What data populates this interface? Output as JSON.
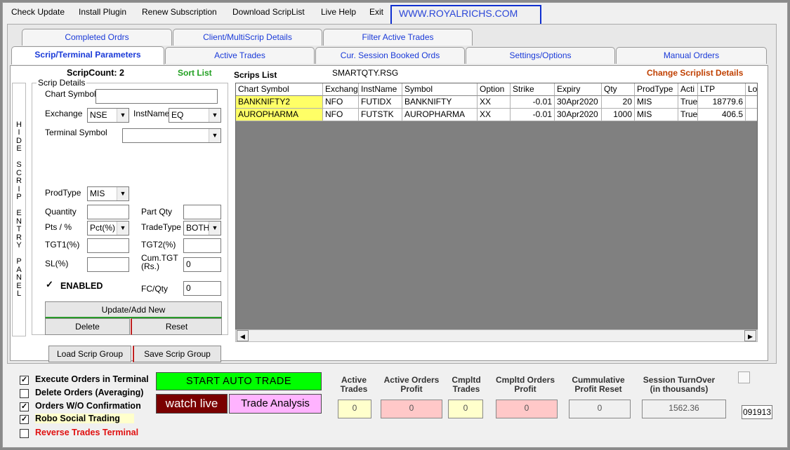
{
  "menu": {
    "items": [
      "Check Update",
      "Install Plugin",
      "Renew Subscription",
      "Download ScripList",
      "Live Help",
      "Exit"
    ],
    "website": "WWW.ROYALRICHS.COM"
  },
  "tabs_row1": [
    "Completed Ordrs",
    "Client/MultiScrip Details",
    "Filter Active Trades"
  ],
  "tabs_row2": [
    "Scrip/Terminal Parameters",
    "Active Trades",
    "Cur. Session Booked Ords",
    "Settings/Options",
    "Manual Orders"
  ],
  "hide_panel_text": [
    "H",
    "I",
    "D",
    "E",
    "",
    "S",
    "C",
    "R",
    "I",
    "P",
    "",
    "E",
    "N",
    "T",
    "R",
    "Y",
    "",
    "P",
    "A",
    "N",
    "E",
    "L"
  ],
  "scrip": {
    "count_label": "ScripCount: 2",
    "sort_list": "Sort List",
    "scrips_list": "Scrips List",
    "file_name": "SMARTQTY.RSG",
    "change_scriplist": "Change Scriplist Details",
    "details_title": "Scrip Details",
    "chart_symbol_label": "Chart Symbol",
    "chart_symbol_value": "",
    "exchange_label": "Exchange",
    "exchange_value": "NSE",
    "instname_label": "InstName",
    "instname_value": "EQ",
    "terminal_symbol_label": "Terminal Symbol",
    "terminal_symbol_value": "",
    "prodtype_label": "ProdType",
    "prodtype_value": "MIS",
    "quantity_label": "Quantity",
    "quantity_value": "",
    "partqty_label": "Part Qty",
    "partqty_value": "",
    "pts_label": "Pts / %",
    "pts_value": "Pct(%)",
    "tradetype_label": "TradeType",
    "tradetype_value": "BOTH",
    "tgt1_label": "TGT1(%)",
    "tgt1_value": "",
    "tgt2_label": "TGT2(%)",
    "tgt2_value": "",
    "sl_label": "SL(%)",
    "sl_value": "",
    "cumtgt_label": "Cum.TGT (Rs.)",
    "cumtgt_value": "0",
    "enabled_label": "ENABLED",
    "fcqty_label": "FC/Qty",
    "fcqty_value": "0",
    "update_btn": "Update/Add New",
    "delete_btn": "Delete",
    "reset_btn": "Reset",
    "load_group_btn": "Load Scrip Group",
    "save_group_btn": "Save Scrip Group"
  },
  "grid": {
    "columns": [
      "Chart Symbol",
      "Exchang",
      "InstName",
      "Symbol",
      "Option",
      "Strike",
      "Expiry",
      "Qty",
      "ProdType",
      "Acti",
      "LTP",
      "Lo"
    ],
    "rows": [
      [
        "BANKNIFTY2",
        "NFO",
        "FUTIDX",
        "BANKNIFTY",
        "XX",
        "-0.01",
        "30Apr2020",
        "20",
        "MIS",
        "True",
        "18779.6",
        ""
      ],
      [
        "AUROPHARMA",
        "NFO",
        "FUTSTK",
        "AUROPHARMA",
        "XX",
        "-0.01",
        "30Apr2020",
        "1000",
        "MIS",
        "True",
        "406.5",
        ""
      ]
    ]
  },
  "bottom": {
    "checks": [
      {
        "label": "Execute Orders in Terminal",
        "checked": true
      },
      {
        "label": "Delete Orders (Averaging)",
        "checked": false
      },
      {
        "label": "Orders W/O Confirmation",
        "checked": true
      },
      {
        "label": "Robo Social Trading",
        "checked": true
      },
      {
        "label": "Reverse Trades Terminal",
        "checked": false
      }
    ],
    "start_btn": "START AUTO TRADE",
    "watch_btn": "watch live",
    "analysis_btn": "Trade Analysis",
    "stats": [
      {
        "h1": "Active",
        "h2": "Trades",
        "value": "0"
      },
      {
        "h1": "Active Orders",
        "h2": "Profit",
        "value": "0"
      },
      {
        "h1": "Cmpltd",
        "h2": "Trades",
        "value": "0"
      },
      {
        "h1": "Cmpltd Orders",
        "h2": "Profit",
        "value": "0"
      },
      {
        "h1": "Cummulative",
        "h2": "Profit Reset",
        "value": "0"
      },
      {
        "h1": "Session TurnOver",
        "h2": "(in thousands)",
        "value": "1562.36"
      }
    ],
    "code": "091913"
  },
  "colors": {
    "tab_text": "#1a3ad8",
    "sort_green": "#22a022",
    "change_orange": "#c04000",
    "start_green": "#00ff00",
    "watch_bg": "#7a0000",
    "analysis_bg": "#ffb3ff",
    "yellow_cell": "#ffff66",
    "pink_box": "#ffc8c8",
    "yellow_box": "#ffffcc"
  }
}
